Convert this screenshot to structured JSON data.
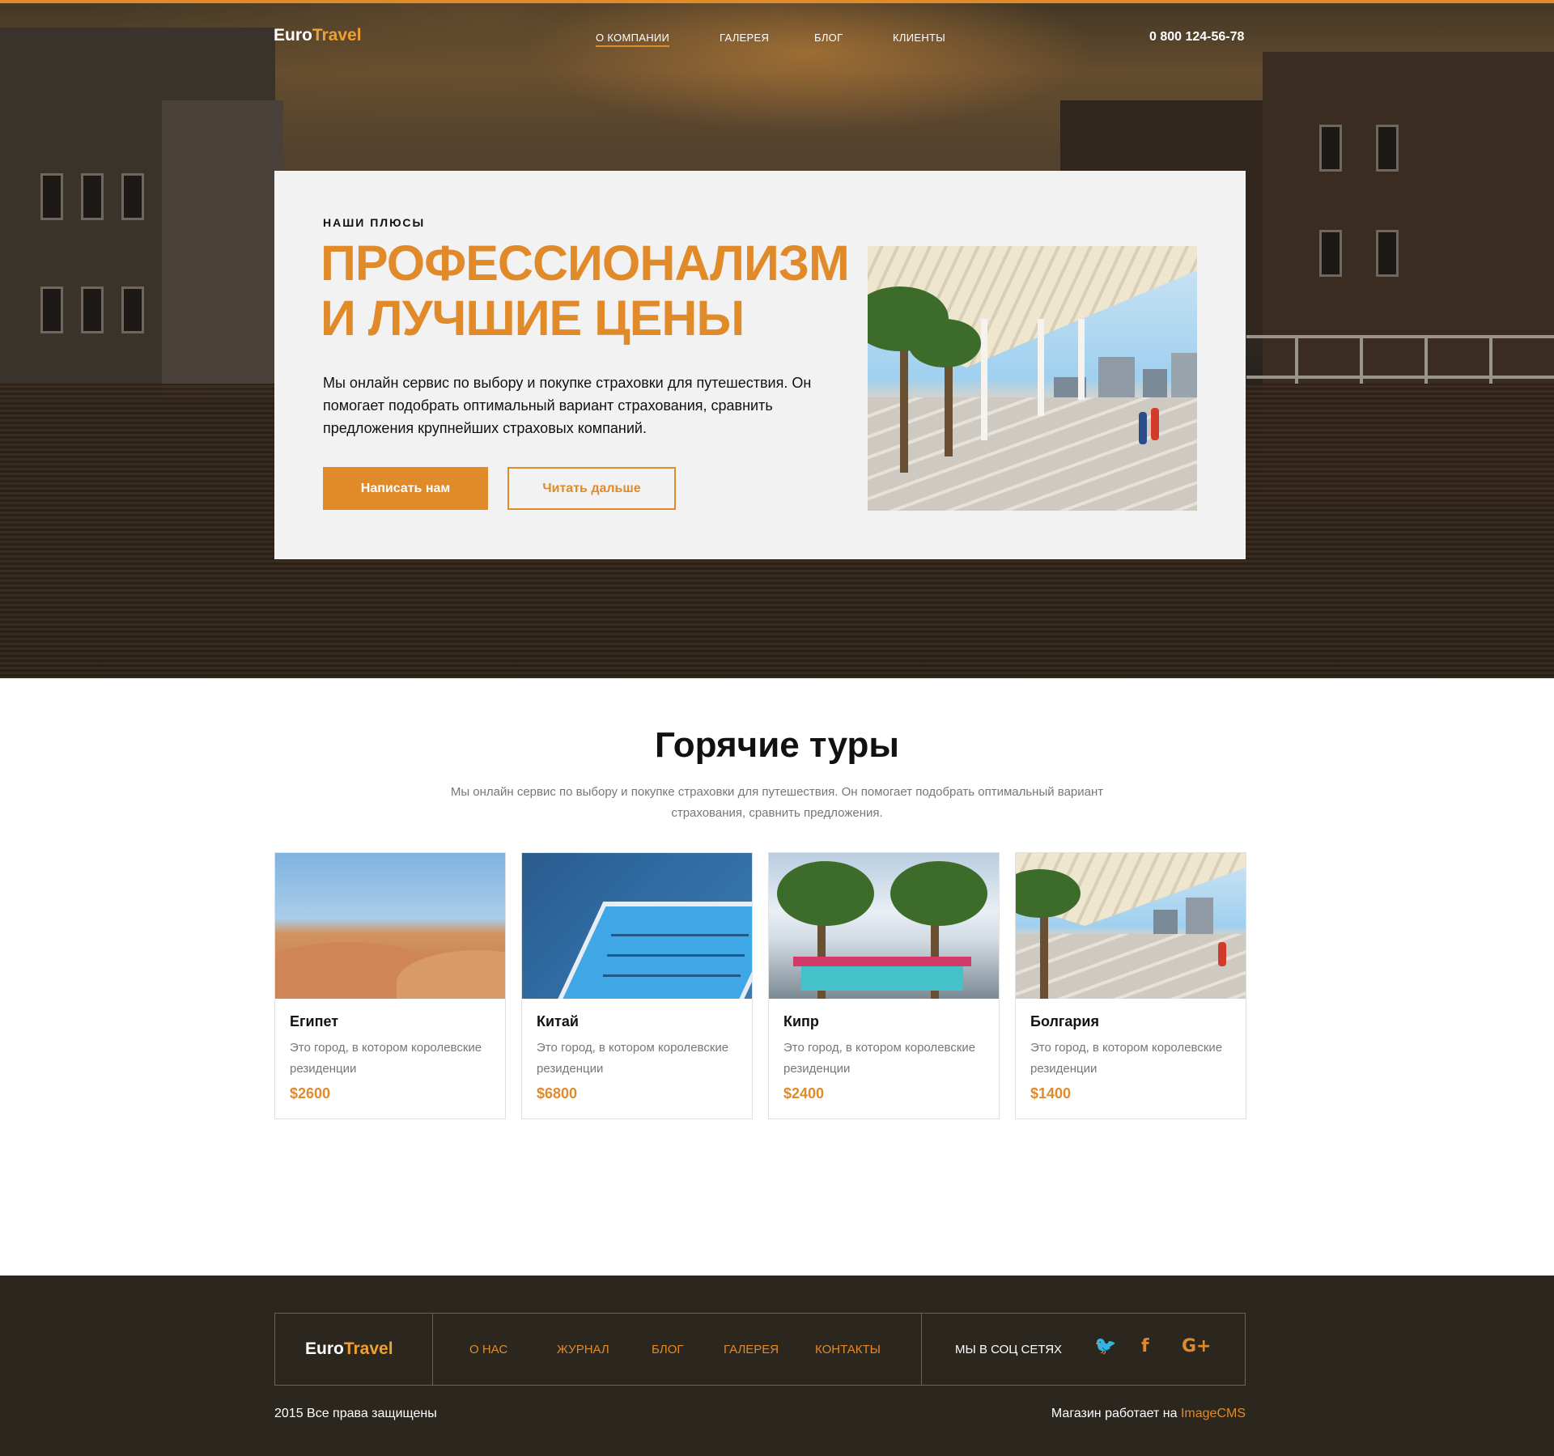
{
  "header": {
    "logo_part1": "Euro",
    "logo_part2": "Travel",
    "nav": [
      {
        "label": "О компании",
        "active": true
      },
      {
        "label": "Галерея"
      },
      {
        "label": "Блог"
      },
      {
        "label": "Клиенты"
      }
    ],
    "phone": "0 800 124-56-78"
  },
  "hero": {
    "eyebrow": "НАШИ ПЛЮСЫ",
    "headline_line1": "ПРОФЕССИОНАЛИЗМ",
    "headline_line2": "И ЛУЧШИЕ ЦЕНЫ",
    "text": "Мы онлайн сервис по выбору и покупке страховки для путешествия. Он помогает подобрать оптимальный вариант страхования, сравнить предложения крупнейших страховых компаний.",
    "primary_button": "Написать нам",
    "secondary_button": "Читать дальше"
  },
  "tours": {
    "title": "Горячие туры",
    "subtitle": "Мы онлайн сервис по выбору и покупке страховки для путешествия. Он помогает подобрать оптимальный вариант страхования, сравнить предложения.",
    "items": [
      {
        "name": "Египет",
        "desc": "Это город, в котором королевские резиденции",
        "price": "$2600"
      },
      {
        "name": "Китай",
        "desc": "Это город, в котором королевские резиденции",
        "price": "$6800"
      },
      {
        "name": "Кипр",
        "desc": "Это город, в котором королевские резиденции",
        "price": "$2400"
      },
      {
        "name": "Болгария",
        "desc": "Это город, в котором королевские резиденции",
        "price": "$1400"
      }
    ]
  },
  "footer": {
    "logo_part1": "Euro",
    "logo_part2": "Travel",
    "nav": [
      "О нас",
      "Журнал",
      "Блог",
      "Галерея",
      "Контакты"
    ],
    "social_label": "Мы в соц сетях",
    "social_icons": [
      "twitter-icon",
      "facebook-icon",
      "google-plus-icon"
    ],
    "social_glyphs": [
      "🐦",
      "f",
      "G+"
    ],
    "copyright": "2015 Все права защищены",
    "powered_prefix": "Магазин работает на ",
    "powered_link": "ImageCMS"
  },
  "colors": {
    "accent": "#e08a2a",
    "footer_bg": "#2b271f",
    "card_bg": "#f2f2f2"
  }
}
